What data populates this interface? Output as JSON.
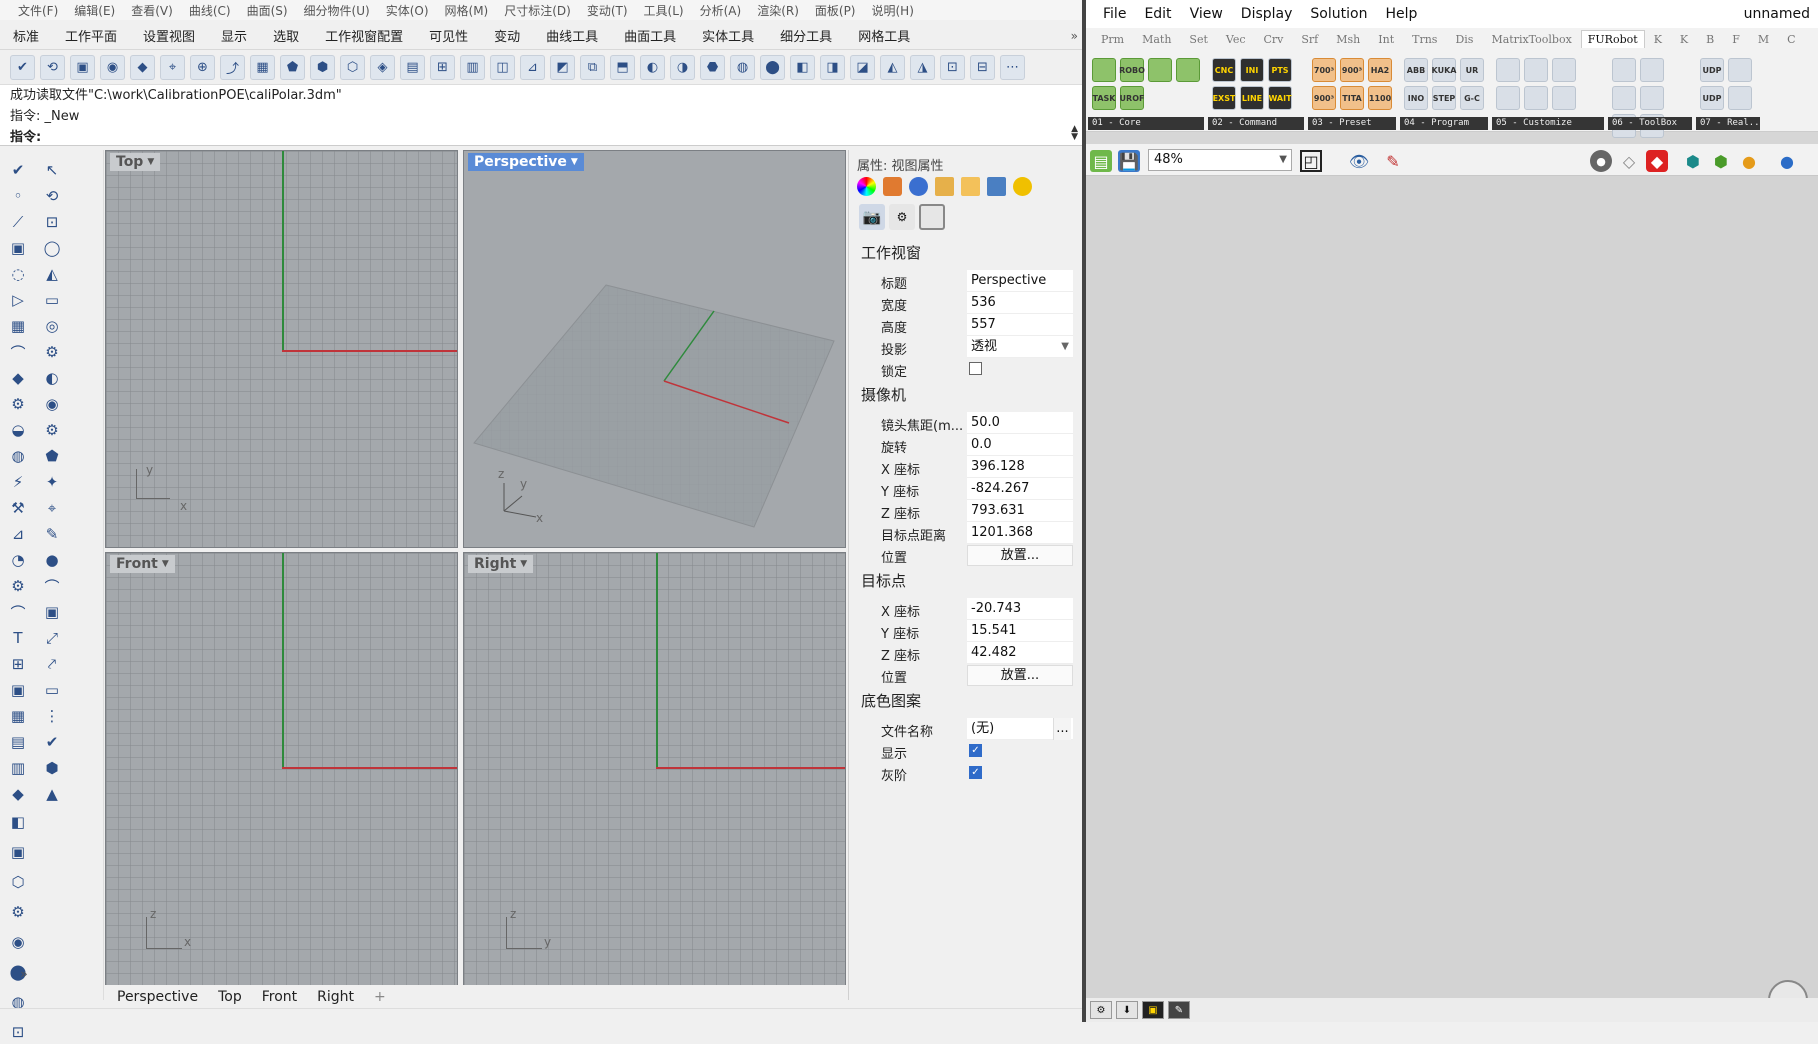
{
  "rhino": {
    "menu": [
      "文件(F)",
      "编辑(E)",
      "查看(V)",
      "曲线(C)",
      "曲面(S)",
      "细分物件(U)",
      "实体(O)",
      "网格(M)",
      "尺寸标注(D)",
      "变动(T)",
      "工具(L)",
      "分析(A)",
      "渲染(R)",
      "面板(P)",
      "说明(H)"
    ],
    "tabs": [
      "标准",
      "工作平面",
      "设置视图",
      "显示",
      "选取",
      "工作视窗配置",
      "可见性",
      "变动",
      "曲线工具",
      "曲面工具",
      "实体工具",
      "细分工具",
      "网格工具"
    ],
    "tabs_more": "»",
    "command": {
      "history": "成功读取文件\"C:\\work\\CalibrationPOE\\caliPolar.3dm\"",
      "last": "指令: _New",
      "prompt": "指令:"
    },
    "viewports": {
      "top": "Top",
      "perspective": "Perspective",
      "front": "Front",
      "right": "Right"
    },
    "viewport_tabs": [
      "Perspective",
      "Top",
      "Front",
      "Right"
    ],
    "add_tab": "+",
    "gnomon": {
      "x": "x",
      "y": "y",
      "z": "z"
    },
    "properties": {
      "title": "属性: 视图属性",
      "sections": {
        "viewport": "工作视窗",
        "camera": "摄像机",
        "target": "目标点",
        "wallpaper": "底色图案"
      },
      "viewport_rows": [
        {
          "key": "标题",
          "value": "Perspective"
        },
        {
          "key": "宽度",
          "value": "536"
        },
        {
          "key": "高度",
          "value": "557"
        },
        {
          "key": "投影",
          "value": "透视"
        },
        {
          "key": "锁定",
          "value": ""
        }
      ],
      "camera_rows": [
        {
          "key": "镜头焦距(m...",
          "value": "50.0"
        },
        {
          "key": "旋转",
          "value": "0.0"
        },
        {
          "key": "X 座标",
          "value": "396.128"
        },
        {
          "key": "Y 座标",
          "value": "-824.267"
        },
        {
          "key": "Z 座标",
          "value": "793.631"
        },
        {
          "key": "目标点距离",
          "value": "1201.368"
        },
        {
          "key": "位置",
          "value": "放置..."
        }
      ],
      "target_rows": [
        {
          "key": "X 座标",
          "value": "-20.743"
        },
        {
          "key": "Y 座标",
          "value": "15.541"
        },
        {
          "key": "Z 座标",
          "value": "42.482"
        },
        {
          "key": "位置",
          "value": "放置..."
        }
      ],
      "wallpaper_rows": [
        {
          "key": "文件名称",
          "value": "(无)"
        },
        {
          "key": "显示",
          "value": "checked"
        },
        {
          "key": "灰阶",
          "value": "checked"
        }
      ],
      "ellipsis": "..."
    }
  },
  "grasshopper": {
    "menu": [
      "File",
      "Edit",
      "View",
      "Display",
      "Solution",
      "Help"
    ],
    "doc_title": "unnamed",
    "categories": [
      "Prm",
      "Math",
      "Set",
      "Vec",
      "Crv",
      "Srf",
      "Msh",
      "Int",
      "Trns",
      "Dis",
      "MatrixToolbox",
      "FURobot",
      "K",
      "K",
      "B",
      "F",
      "M",
      "C"
    ],
    "selected_category": "FURobot",
    "groups": [
      {
        "label": "01 - Core",
        "icons": [
          "",
          "ROBO",
          "",
          "",
          "TASK",
          "UROF"
        ]
      },
      {
        "label": "02 - Command",
        "icons": [
          "CNC",
          "INI",
          "PTS",
          "EXST",
          "LINE",
          "WAIT"
        ]
      },
      {
        "label": "03 - Preset",
        "icons": [
          "700³",
          "900³",
          "HA2",
          "900³",
          "TITA",
          "1100"
        ]
      },
      {
        "label": "04 - Program",
        "icons": [
          "ABB",
          "KUKA",
          "UR",
          "INO",
          "STEP",
          "G-C"
        ]
      },
      {
        "label": "05 - Customize",
        "icons": [
          "",
          "",
          "",
          "",
          "",
          ""
        ]
      },
      {
        "label": "06 - ToolBox",
        "icons": [
          "",
          "",
          "",
          "",
          "",
          ""
        ]
      },
      {
        "label": "07 - Real...",
        "icons": [
          "UDP",
          "",
          "UDP",
          ""
        ]
      }
    ],
    "zoom": "48%"
  },
  "colors": {
    "accent": "#2f6bc9",
    "x_axis": "#c0343a",
    "y_axis": "#2e8a3c",
    "viewport_bg": "#a4a8ac"
  }
}
